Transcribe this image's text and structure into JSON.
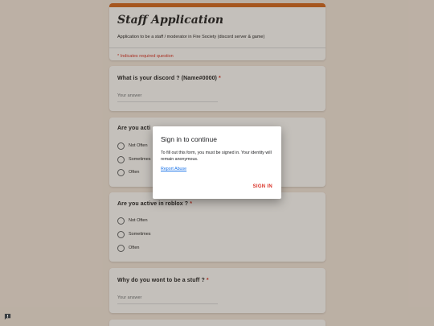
{
  "form": {
    "title": "Staff Application",
    "description": "Application to be a staff / moderator in Fire Society (discord server & game)",
    "required_note": "* Indicates required question",
    "accent_color": "#d5671f",
    "background_color": "#f3e8df"
  },
  "questions": [
    {
      "text": "What is your discord ? (Name#0000)",
      "required_mark": "*",
      "answer_placeholder": "Your answer"
    },
    {
      "text": "Are you acti",
      "options": [
        "Not Often",
        "Sometimes",
        "Often"
      ]
    },
    {
      "text": "Are you active in roblox ?",
      "required_mark": "*",
      "options": [
        "Not Often",
        "Sometimes",
        "Often"
      ]
    },
    {
      "text": "Why do you wont to be a stuff ?",
      "required_mark": "*",
      "answer_placeholder": "Your answer"
    }
  ],
  "dialog": {
    "title": "Sign in to continue",
    "body": "To fill out this form, you must be signed in. Your identity will remain anonymous.",
    "link": "Report Abuse",
    "button": "SIGN IN",
    "button_color": "#d93025"
  },
  "feedback_icon": "feedback-icon"
}
